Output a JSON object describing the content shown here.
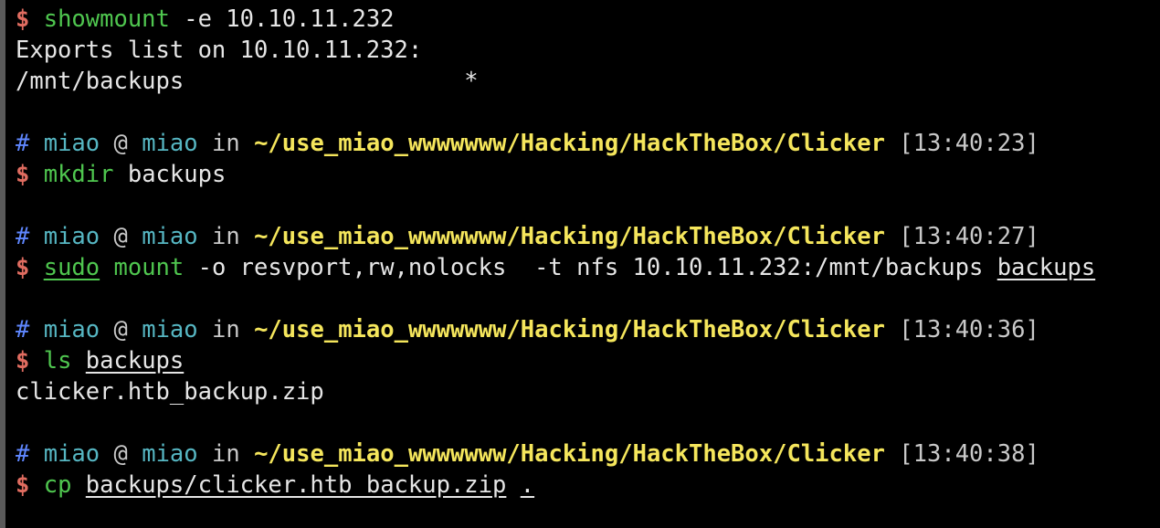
{
  "terminal": {
    "prompt_symbol": "$",
    "header_symbol": "#",
    "header": {
      "user": "miao",
      "at": "@",
      "host": "miao",
      "in": "in",
      "path": "~/use_miao_wwwwwww/Hacking/HackTheBox/Clicker"
    },
    "line1": {
      "cmd": "showmount",
      "args": " -e 10.10.11.232"
    },
    "output1": [
      "Exports list on 10.10.11.232:",
      "/mnt/backups                    *"
    ],
    "block2": {
      "time": "[13:40:23]",
      "cmd": "mkdir",
      "args": " backups"
    },
    "block3": {
      "time": "[13:40:27]",
      "cmd_sudo": "sudo",
      "cmd": "mount",
      "args": " -o resvport,rw,nolocks  -t nfs 10.10.11.232:/mnt/backups ",
      "target": "backups"
    },
    "block4": {
      "time": "[13:40:36]",
      "cmd": "ls",
      "target": "backups",
      "output": "clicker.htb_backup.zip"
    },
    "block5": {
      "time": "[13:40:38]",
      "cmd": "cp",
      "source": "backups/clicker.htb_backup.zip",
      "dest": "."
    }
  },
  "colors": {
    "background": "#000000",
    "prompt": "#e06c60",
    "command": "#4fc64f",
    "hash": "#5f87ff",
    "user": "#56b6c2",
    "path": "#f5e65c",
    "text": "#e6e6e6"
  }
}
